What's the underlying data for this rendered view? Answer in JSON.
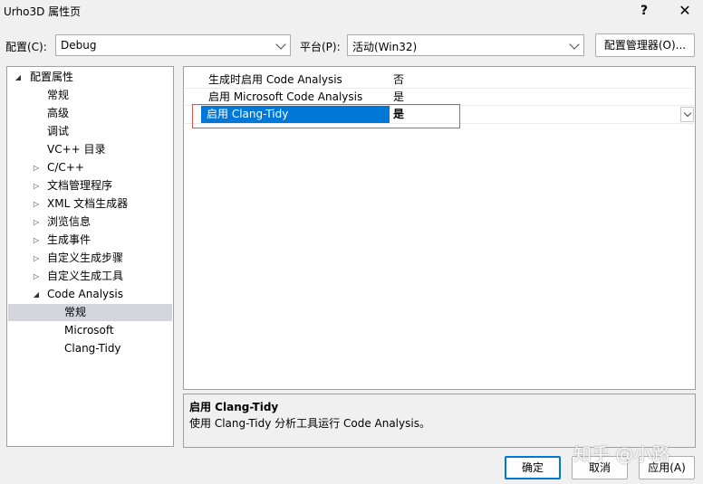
{
  "window": {
    "title": "Urho3D 属性页",
    "help": "?",
    "close": "✕"
  },
  "toolbar": {
    "config_label": "配置(C):",
    "config_value": "Debug",
    "platform_label": "平台(P):",
    "platform_value": "活动(Win32)",
    "config_manager": "配置管理器(O)..."
  },
  "tree": {
    "items": [
      {
        "label": "配置属性",
        "toggle": "◢"
      },
      {
        "label": "常规"
      },
      {
        "label": "高级"
      },
      {
        "label": "调试"
      },
      {
        "label": "VC++ 目录"
      },
      {
        "label": "C/C++",
        "toggle": "▷"
      },
      {
        "label": "文档管理程序",
        "toggle": "▷"
      },
      {
        "label": "XML 文档生成器",
        "toggle": "▷"
      },
      {
        "label": "浏览信息",
        "toggle": "▷"
      },
      {
        "label": "生成事件",
        "toggle": "▷"
      },
      {
        "label": "自定义生成步骤",
        "toggle": "▷"
      },
      {
        "label": "自定义生成工具",
        "toggle": "▷"
      },
      {
        "label": "Code Analysis",
        "toggle": "◢"
      },
      {
        "label": "常规"
      },
      {
        "label": "Microsoft"
      },
      {
        "label": "Clang-Tidy"
      }
    ]
  },
  "properties": [
    {
      "name": "生成时启用 Code Analysis",
      "value": "否"
    },
    {
      "name": "启用 Microsoft Code Analysis",
      "value": "是"
    },
    {
      "name": "启用 Clang-Tidy",
      "value": "是"
    }
  ],
  "description": {
    "title": "启用 Clang-Tidy",
    "text": "使用 Clang-Tidy 分析工具运行 Code Analysis。"
  },
  "buttons": {
    "ok": "确定",
    "cancel": "取消",
    "apply": "应用(A)"
  },
  "watermark": "知乎 @小路",
  "colors": {
    "selection": "#0078d7",
    "highlight_box": "#d9534f",
    "tree_selected": "#d4d4dc"
  }
}
